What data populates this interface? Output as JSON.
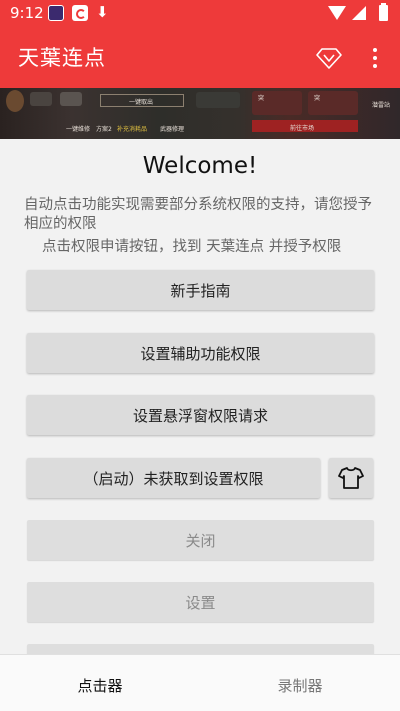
{
  "status_bar": {
    "time": "9:12",
    "icons": [
      "app-notification-icon",
      "app-notification-icon",
      "download-icon",
      "wifi-icon",
      "signal-icon",
      "battery-icon"
    ]
  },
  "app_bar": {
    "title": "天葉连点",
    "actions": [
      "diamond-icon",
      "more-vert-icon"
    ],
    "color": "#ee3a3a"
  },
  "banner": {
    "labels": [
      "一键取出",
      "一键维修",
      "方案2",
      "补充消耗品",
      "武器修理",
      "前往市场",
      "突",
      "突",
      "潜雷站"
    ]
  },
  "main": {
    "welcome": "Welcome!",
    "description": "自动点击功能实现需要部分系统权限的支持，请您授予相应的权限",
    "hint": "点击权限申请按钮，找到 天葉连点 并授予权限",
    "buttons": {
      "guide": "新手指南",
      "accessibility": "设置辅助功能权限",
      "overlay": "设置悬浮窗权限请求",
      "start": "（启动）未获取到设置权限",
      "close": "关闭",
      "settings": "设置"
    }
  },
  "bottom_nav": {
    "tabs": [
      {
        "label": "点击器",
        "active": true
      },
      {
        "label": "录制器",
        "active": false
      }
    ]
  }
}
